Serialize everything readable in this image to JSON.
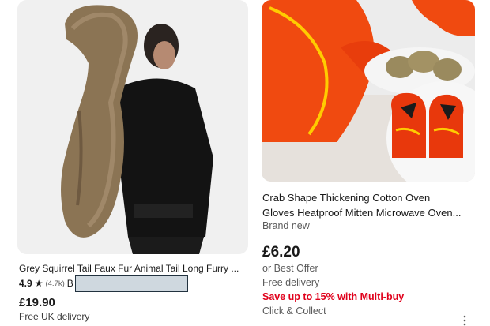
{
  "listings": [
    {
      "title": "Grey Squirrel Tail Faux Fur Animal Tail Long Furry ...",
      "rating": "4.9",
      "rating_count": "(4.7k)",
      "seller_prefix": "B",
      "price": "£19.90",
      "delivery": "Free UK delivery",
      "image_icon": "squirrel-tail-photo"
    },
    {
      "title_line1": "Crab Shape Thickening Cotton Oven",
      "title_line2": "Gloves Heatproof Mitten Microwave Oven...",
      "condition": "Brand new",
      "price": "£6.20",
      "best_offer": "or Best Offer",
      "delivery": "Free delivery",
      "promo": "Save up to 15% with Multi-buy",
      "collect": "Click & Collect",
      "image_icon": "crab-oven-gloves-photo"
    }
  ],
  "colors": {
    "promo": "#e0001b",
    "text": "#191919",
    "muted": "#5b5b5b"
  }
}
